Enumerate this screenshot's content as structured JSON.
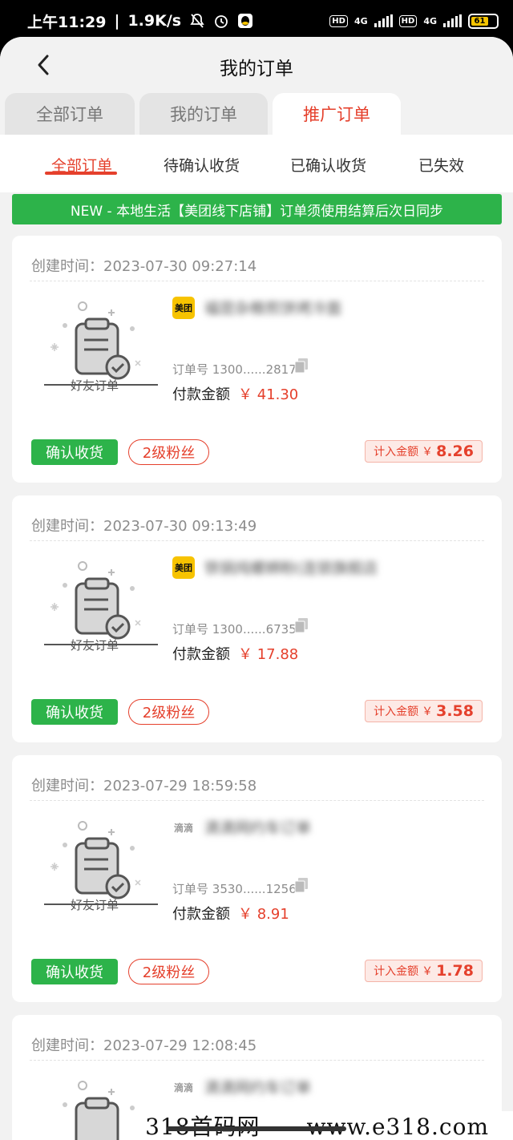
{
  "status_bar": {
    "time": "上午11:29",
    "speed": "1.9K/s",
    "network1": "4G",
    "network2": "4G",
    "hd1": "HD",
    "hd2": "HD",
    "battery": "61"
  },
  "header": {
    "title": "我的订单",
    "back_icon": "chevron-left-icon"
  },
  "tabs": [
    {
      "label": "全部订单",
      "active": false
    },
    {
      "label": "我的订单",
      "active": false
    },
    {
      "label": "推广订单",
      "active": true
    }
  ],
  "subtabs": [
    {
      "label": "全部订单",
      "active": true
    },
    {
      "label": "待确认收货",
      "active": false
    },
    {
      "label": "已确认收货",
      "active": false
    },
    {
      "label": "已失效",
      "active": false
    }
  ],
  "notice": "NEW - 本地生活【美团线下店铺】订单须使用结算后次日同步",
  "labels": {
    "created_prefix": "创建时间：",
    "order_no_prefix": "订单号",
    "pay_label": "付款金额",
    "illus_label": "好友订单",
    "confirm": "确认收货",
    "fans": "2级粉丝",
    "commission_label": "计入金额",
    "currency": "￥"
  },
  "orders": [
    {
      "created": "2023-07-30 09:27:14",
      "brand": "美团",
      "shop_name": "福昆杂粮煎饼烤冷面",
      "order_no": "1300......2817",
      "pay_amount": "￥ 41.30",
      "commission": "8.26"
    },
    {
      "created": "2023-07-30 09:13:49",
      "brand": "美团",
      "shop_name": "铁锅炖螺蛳粉(连锁旗舰店",
      "order_no": "1300......6735",
      "pay_amount": "￥ 17.88",
      "commission": "3.58"
    },
    {
      "created": "2023-07-29 18:59:58",
      "brand": "滴滴",
      "shop_name": "滴滴网约车订单",
      "order_no": "3530......1256",
      "pay_amount": "￥ 8.91",
      "commission": "1.78"
    },
    {
      "created": "2023-07-29 12:08:45",
      "brand": "滴滴",
      "shop_name": "滴滴网约车订单"
    }
  ],
  "watermark": "318首码网——www.e318.com",
  "colors": {
    "accent": "#e5402c",
    "green": "#2db34a",
    "background": "#f2f2f2"
  }
}
